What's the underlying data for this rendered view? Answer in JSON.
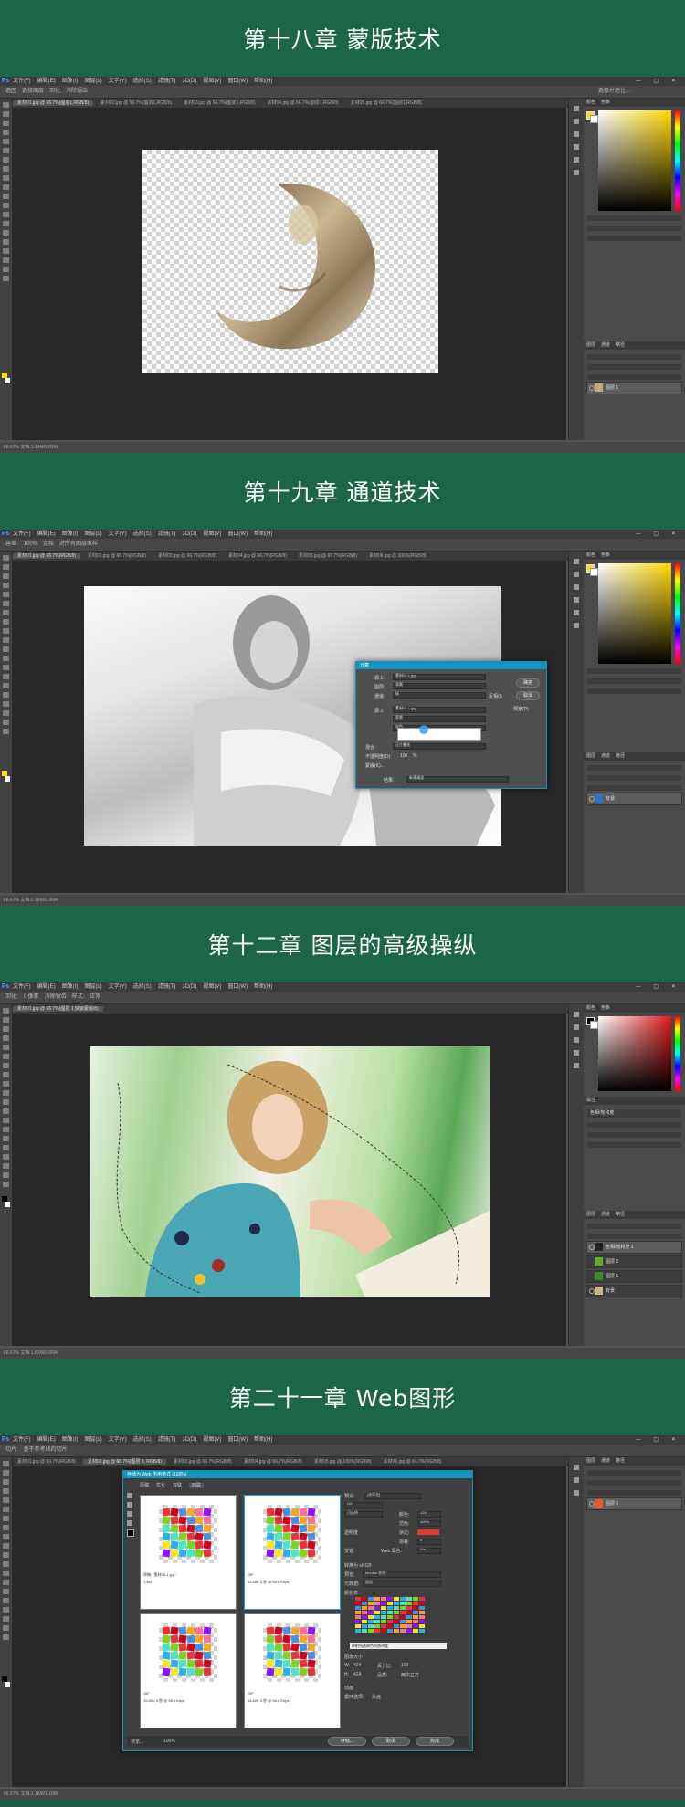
{
  "sections": [
    {
      "title": "第十八章 蒙版技术"
    },
    {
      "title": "第十九章 通道技术"
    },
    {
      "title": "第十二章 图层的高级操纵"
    },
    {
      "title": "第二十一章 Web图形"
    }
  ],
  "ps": {
    "logo": "Ps",
    "menus": [
      "文件(F)",
      "编辑(E)",
      "图像(I)",
      "图层(L)",
      "文字(Y)",
      "选择(S)",
      "滤镜(T)",
      "3D(D)",
      "视图(V)",
      "窗口(W)",
      "帮助(H)"
    ],
    "window_controls": "— ▢ ✕",
    "panel_tabs_color": [
      "颜色",
      "色板"
    ],
    "panel_tabs_layers": [
      "图层",
      "通道",
      "路径"
    ]
  },
  "screen1": {
    "options": [
      "选区",
      "选择图层",
      "羽化",
      "消除锯齿"
    ],
    "options_right": "选择并遮住...",
    "tabs": [
      "素材01.jpg @ 66.7%(图层1,RGB/8)",
      "素材02.jpg @ 50.7%(图层1,RGB/8)",
      "素材03.jpg @ 66.7%(图层1,RGB/8)",
      "素材04.jpg @ 66.7%(图层1,RGB/8)",
      "素材05.jpg @ 66.7%(图层1,RGB/8)"
    ],
    "status": "66.67%   文档:1.24M/2.01M",
    "layers": [
      {
        "name": "图层 1",
        "selected": true
      }
    ]
  },
  "screen2": {
    "options": [
      "容差:",
      "100%",
      "连续",
      "对所有图层取样"
    ],
    "tabs": [
      "素材01.jpg @ 66.7%(RGB/8)",
      "素材02.jpg @ 66.7%(RGB/8)",
      "素材03.jpg @ 66.7%(RGB/8)",
      "素材04.jpg @ 66.7%(RGB/8)",
      "素材05.jpg @ 66.7%(RGB/8)",
      "素材06.jpg @ 100%(RGB/8)"
    ],
    "status": "66.67%   文档:2.36M/2.36M",
    "dialog": {
      "title": "计算",
      "src1_label": "源 1:",
      "src1_value": "素材02-1.jpg",
      "layer_label": "图层:",
      "layer_value": "背景",
      "channel_label": "通道:",
      "channel_value": "绿",
      "invert_label": "反相(I)",
      "src2_label": "源 2:",
      "src2_value": "素材02-1.jpg",
      "layer2_value": "背景",
      "channel2_value": "灰色",
      "blend_label": "混合:",
      "blend_value": "正片叠底",
      "opacity_label": "不透明度(O):",
      "opacity_value": "100",
      "opacity_unit": "%",
      "mask_label": "蒙版(K)...",
      "result_label": "结果:",
      "result_value": "新建通道",
      "ok": "确定",
      "cancel": "取消",
      "preview_label": "预览(P)"
    },
    "layers": [
      {
        "name": "背景",
        "selected": true
      }
    ]
  },
  "screen3": {
    "options": [
      "羽化:",
      "0 像素",
      "消除锯齿",
      "样式:",
      "正常"
    ],
    "tabs": [
      "素材01.jpg @ 66.7%(图层 1,快速蒙版/8)"
    ],
    "status": "66.67%   文档:1.82M/3.66M",
    "layers": [
      {
        "name": "色相/饱和度 1",
        "selected": true
      },
      {
        "name": "图层 2",
        "selected": false
      },
      {
        "name": "图层 1",
        "selected": false
      },
      {
        "name": "背景",
        "selected": false
      }
    ],
    "props_title": "属性",
    "props_row": "色相/饱和度"
  },
  "screen4": {
    "options": [
      "切片:",
      "基于参考线的切片"
    ],
    "tabs": [
      "素材01.jpg @ 66.7%(RGB/8)",
      "素材02.jpg @ 66.7%(图层 0, RGB/8)",
      "素材03.jpg @ 66.7%(RGB/8)",
      "素材04.jpg @ 66.7%(RGB/8)",
      "素材05.jpg @ 100%(RGB/8)",
      "素材06.jpg @ 66.7%(RGB/8)"
    ],
    "status": "66.67%   文档:1.16M/1.16M",
    "dialog": {
      "title": "存储为 Web 所用格式 (100%)",
      "view_tabs": [
        "原稿",
        "优化",
        "双联",
        "四联"
      ],
      "preset_label": "预设:",
      "preset_value": "[未命名]",
      "format_value": "GIF",
      "reduction_value": "可选择",
      "colors_label": "颜色:",
      "colors_value": "128",
      "dither_label": "仿色:",
      "dither_value": "100%",
      "transparency_label": "透明度",
      "matte_label": "杂边:",
      "interlaced_label": "交错",
      "websnap_label": "Web 靠色:",
      "websnap_value": "0%",
      "lossy_label": "损耗:",
      "lossy_value": "0",
      "convert_label": "转换为 sRGB",
      "preview_label": "预览:",
      "preview_value": "Monitor 颜色",
      "metadata_label": "元数据:",
      "metadata_value": "版权",
      "color_table_label": "颜色表",
      "image_size_label": "图像大小",
      "w_label": "W:",
      "w_value": "424",
      "h_label": "H:",
      "h_value": "424",
      "percent_label": "百分比:",
      "percent_value": "100",
      "quality_label": "品质:",
      "quality_value": "两次立方",
      "tooltip": "映射所选颜色的透明度",
      "anim_label": "动画",
      "loop_label": "循环选项:",
      "loop_value": "永远",
      "panes": [
        {
          "line1": "原稿: \"素材05-1.jpg\"",
          "line2": "1.4M"
        },
        {
          "line1": "GIF",
          "line2": "15.88K  3 秒 @ 56.6 Kbps"
        },
        {
          "line1": "GIF",
          "line2": "15.82K  3 秒 @ 56.6 Kbps"
        },
        {
          "line1": "GIF",
          "line2": "15.82K  3 秒 @ 56.6 Kbps"
        }
      ],
      "zoom_value": "100%",
      "save": "存储...",
      "cancel": "取消",
      "done": "完成",
      "preview_btn": "预览..."
    },
    "layers": [
      {
        "name": "图层 0",
        "selected": true
      }
    ]
  }
}
